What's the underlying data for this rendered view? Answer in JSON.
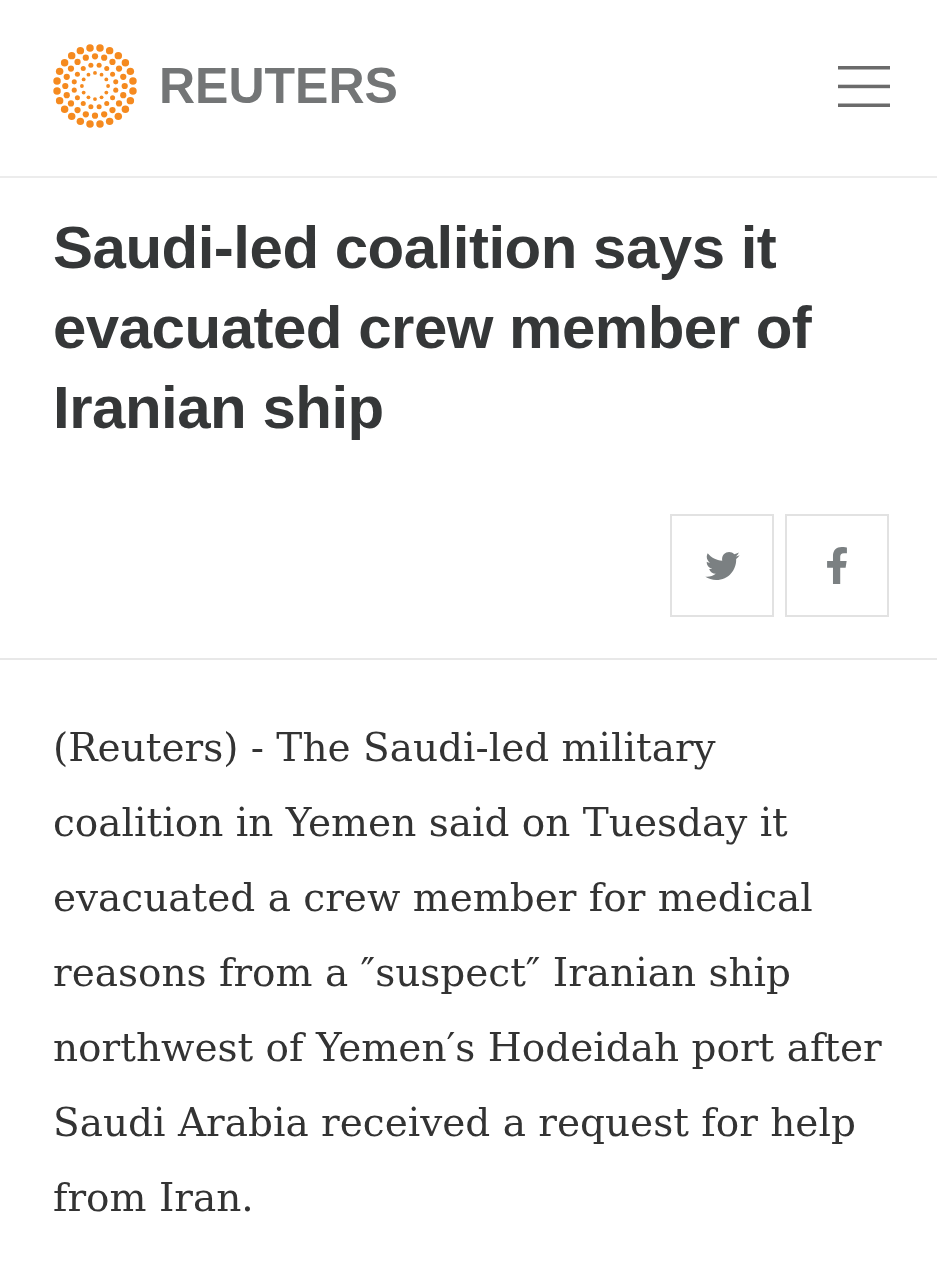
{
  "header": {
    "logo_text": "REUTERS"
  },
  "headline": "Saudi-led coalition says it evacuated crew member of Iranian ship",
  "share_buttons": [
    {
      "kind": "twitter"
    },
    {
      "kind": "facebook"
    }
  ],
  "article": {
    "paragraphs": [
      "(Reuters) - The Saudi-led military coalition in Yemen said on Tuesday it evacuated a crew member for medical reasons from a ″suspect″ Iranian ship northwest of Yemen′s Hodeidah port after Saudi Arabia received a request for help from Iran."
    ]
  }
}
